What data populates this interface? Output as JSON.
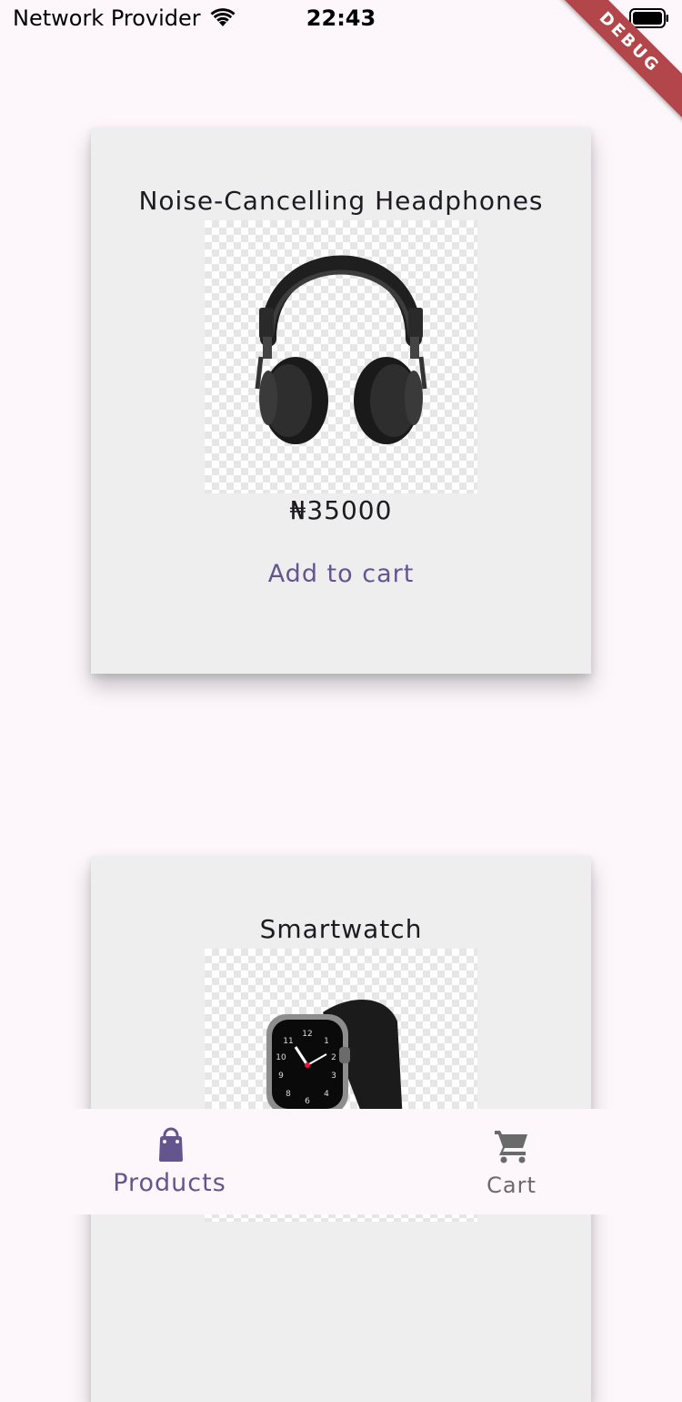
{
  "status_bar": {
    "carrier": "Network Provider",
    "time": "22:43"
  },
  "debug_banner": "DEBUG",
  "products": [
    {
      "name": "Noise-Cancelling Headphones",
      "price": "₦35000",
      "action_label": "Add to cart",
      "image_icon": "headphones-image"
    },
    {
      "name": "Smartwatch",
      "image_icon": "smartwatch-image"
    }
  ],
  "bottom_nav": {
    "products_label": "Products",
    "products_icon": "shopping-bag-icon",
    "cart_label": "Cart",
    "cart_icon": "shopping-cart-icon",
    "selected": "Products"
  },
  "colors": {
    "background": "#fdf7fc",
    "card": "#eeeeee",
    "accent": "#65558f",
    "inactive": "#6a6a6a",
    "debug_ribbon": "#b3464a"
  }
}
